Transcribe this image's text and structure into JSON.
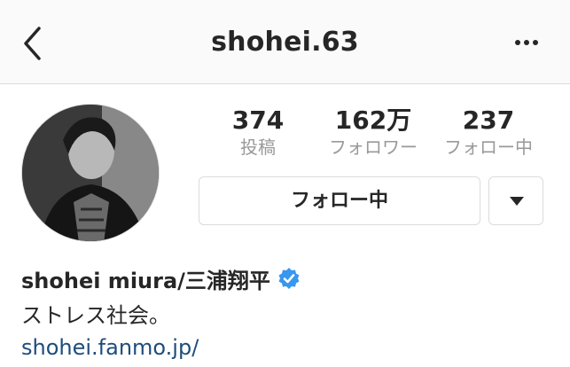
{
  "header": {
    "username": "shohei.63",
    "back_icon": "chevron-left-icon",
    "more_icon": "more-horizontal-icon"
  },
  "profile": {
    "stats": [
      {
        "count": "374",
        "label": "投稿"
      },
      {
        "count": "162万",
        "label": "フォロワー"
      },
      {
        "count": "237",
        "label": "フォロー中"
      }
    ],
    "follow_button_label": "フォロー中",
    "dropdown_icon": "caret-down-icon",
    "name": "shohei miura/三浦翔平",
    "verified_icon": "verified-badge-icon",
    "bio": "ストレス社会。",
    "link": "shohei.fanmo.jp/"
  },
  "colors": {
    "header_bg": "#fafafa",
    "border": "#dbdbdb",
    "verified_blue": "#3897f0",
    "link": "#1e4d7a",
    "muted": "#999999"
  }
}
